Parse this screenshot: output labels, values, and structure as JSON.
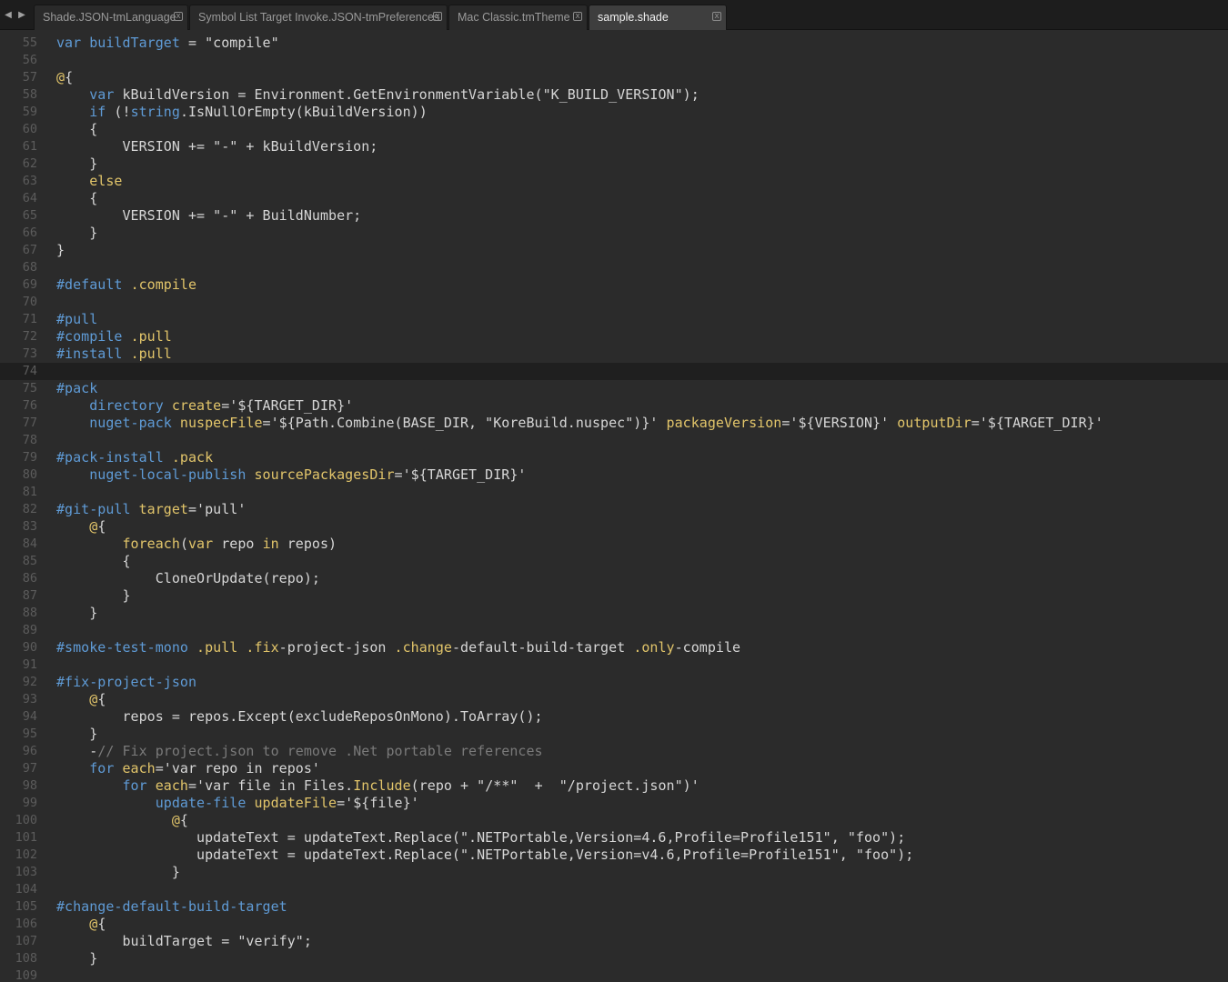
{
  "tabbar": {
    "back_arrow": "◀",
    "forward_arrow": "▶",
    "close_glyph": "x",
    "tabs": [
      {
        "label": "Shade.JSON-tmLanguage",
        "active": false
      },
      {
        "label": "Symbol List Target Invoke.JSON-tmPreferences",
        "active": false
      },
      {
        "label": "Mac Classic.tmTheme",
        "active": false
      },
      {
        "label": "sample.shade",
        "active": true
      }
    ]
  },
  "editor": {
    "current_line": 74,
    "colors": {
      "background": "#2b2b2b",
      "keyword_blue": "#5f9bd6",
      "keyword_gold": "#e2c56a",
      "comment": "#7a7a7a",
      "text": "#d6d6d6"
    },
    "lines": [
      {
        "n": "55",
        "segs": [
          [
            "k",
            "var"
          ],
          [
            "t",
            " "
          ],
          [
            "k",
            "buildTarget"
          ],
          [
            "t",
            " = \"compile\""
          ]
        ]
      },
      {
        "n": "56",
        "segs": []
      },
      {
        "n": "57",
        "segs": [
          [
            "y",
            "@"
          ],
          [
            "t",
            "{"
          ]
        ]
      },
      {
        "n": "58",
        "segs": [
          [
            "t",
            "    "
          ],
          [
            "k",
            "var"
          ],
          [
            "t",
            " kBuildVersion = Environment.GetEnvironmentVariable(\"K_BUILD_VERSION\");"
          ]
        ]
      },
      {
        "n": "59",
        "segs": [
          [
            "t",
            "    "
          ],
          [
            "k",
            "if"
          ],
          [
            "t",
            " (!"
          ],
          [
            "k",
            "string"
          ],
          [
            "t",
            ".IsNullOrEmpty(kBuildVersion))"
          ]
        ]
      },
      {
        "n": "60",
        "segs": [
          [
            "t",
            "    {"
          ]
        ]
      },
      {
        "n": "61",
        "segs": [
          [
            "t",
            "        VERSION += \"-\" + kBuildVersion;"
          ]
        ]
      },
      {
        "n": "62",
        "segs": [
          [
            "t",
            "    }"
          ]
        ]
      },
      {
        "n": "63",
        "segs": [
          [
            "t",
            "    "
          ],
          [
            "y",
            "else"
          ]
        ]
      },
      {
        "n": "64",
        "segs": [
          [
            "t",
            "    {"
          ]
        ]
      },
      {
        "n": "65",
        "segs": [
          [
            "t",
            "        VERSION += \"-\" + BuildNumber;"
          ]
        ]
      },
      {
        "n": "66",
        "segs": [
          [
            "t",
            "    }"
          ]
        ]
      },
      {
        "n": "67",
        "segs": [
          [
            "t",
            "}"
          ]
        ]
      },
      {
        "n": "68",
        "segs": []
      },
      {
        "n": "69",
        "segs": [
          [
            "k",
            "#default"
          ],
          [
            "t",
            " "
          ],
          [
            "y",
            ".compile"
          ]
        ]
      },
      {
        "n": "70",
        "segs": []
      },
      {
        "n": "71",
        "segs": [
          [
            "k",
            "#pull"
          ]
        ]
      },
      {
        "n": "72",
        "segs": [
          [
            "k",
            "#compile"
          ],
          [
            "t",
            " "
          ],
          [
            "y",
            ".pull"
          ]
        ]
      },
      {
        "n": "73",
        "segs": [
          [
            "k",
            "#install"
          ],
          [
            "t",
            " "
          ],
          [
            "y",
            ".pull"
          ]
        ]
      },
      {
        "n": "74",
        "segs": []
      },
      {
        "n": "75",
        "segs": [
          [
            "k",
            "#pack"
          ]
        ]
      },
      {
        "n": "76",
        "segs": [
          [
            "t",
            "    "
          ],
          [
            "k",
            "directory"
          ],
          [
            "t",
            " "
          ],
          [
            "y",
            "create"
          ],
          [
            "t",
            "='${TARGET_DIR}'"
          ]
        ]
      },
      {
        "n": "77",
        "segs": [
          [
            "t",
            "    "
          ],
          [
            "k",
            "nuget-pack"
          ],
          [
            "t",
            " "
          ],
          [
            "y",
            "nuspecFile"
          ],
          [
            "t",
            "='${Path.Combine(BASE_DIR, \"KoreBuild.nuspec\")}' "
          ],
          [
            "y",
            "packageVersion"
          ],
          [
            "t",
            "='${VERSION}' "
          ],
          [
            "y",
            "outputDir"
          ],
          [
            "t",
            "='${TARGET_DIR}'"
          ]
        ]
      },
      {
        "n": "78",
        "segs": []
      },
      {
        "n": "79",
        "segs": [
          [
            "k",
            "#pack-install"
          ],
          [
            "t",
            " "
          ],
          [
            "y",
            ".pack"
          ]
        ]
      },
      {
        "n": "80",
        "segs": [
          [
            "t",
            "    "
          ],
          [
            "k",
            "nuget-local-publish"
          ],
          [
            "t",
            " "
          ],
          [
            "y",
            "sourcePackagesDir"
          ],
          [
            "t",
            "='${TARGET_DIR}'"
          ]
        ]
      },
      {
        "n": "81",
        "segs": []
      },
      {
        "n": "82",
        "segs": [
          [
            "k",
            "#git-pull"
          ],
          [
            "t",
            " "
          ],
          [
            "y",
            "target"
          ],
          [
            "t",
            "='pull'"
          ]
        ]
      },
      {
        "n": "83",
        "segs": [
          [
            "t",
            "    "
          ],
          [
            "y",
            "@"
          ],
          [
            "t",
            "{"
          ]
        ]
      },
      {
        "n": "84",
        "segs": [
          [
            "t",
            "        "
          ],
          [
            "y",
            "foreach"
          ],
          [
            "t",
            "("
          ],
          [
            "y",
            "var"
          ],
          [
            "t",
            " repo "
          ],
          [
            "y",
            "in"
          ],
          [
            "t",
            " repos)"
          ]
        ]
      },
      {
        "n": "85",
        "segs": [
          [
            "t",
            "        {"
          ]
        ]
      },
      {
        "n": "86",
        "segs": [
          [
            "t",
            "            CloneOrUpdate(repo);"
          ]
        ]
      },
      {
        "n": "87",
        "segs": [
          [
            "t",
            "        }"
          ]
        ]
      },
      {
        "n": "88",
        "segs": [
          [
            "t",
            "    }"
          ]
        ]
      },
      {
        "n": "89",
        "segs": []
      },
      {
        "n": "90",
        "segs": [
          [
            "k",
            "#smoke-test-mono"
          ],
          [
            "t",
            " "
          ],
          [
            "y",
            ".pull"
          ],
          [
            "t",
            " "
          ],
          [
            "y",
            ".fix"
          ],
          [
            "t",
            "-project-json "
          ],
          [
            "y",
            ".change"
          ],
          [
            "t",
            "-default-build-target "
          ],
          [
            "y",
            ".only"
          ],
          [
            "t",
            "-compile"
          ]
        ]
      },
      {
        "n": "91",
        "segs": []
      },
      {
        "n": "92",
        "segs": [
          [
            "k",
            "#fix-project-json"
          ]
        ]
      },
      {
        "n": "93",
        "segs": [
          [
            "t",
            "    "
          ],
          [
            "y",
            "@"
          ],
          [
            "t",
            "{"
          ]
        ]
      },
      {
        "n": "94",
        "segs": [
          [
            "t",
            "        repos = repos.Except(excludeReposOnMono).ToArray();"
          ]
        ]
      },
      {
        "n": "95",
        "segs": [
          [
            "t",
            "    }"
          ]
        ]
      },
      {
        "n": "96",
        "segs": [
          [
            "t",
            "    -"
          ],
          [
            "c",
            "// Fix project.json to remove .Net portable references"
          ]
        ]
      },
      {
        "n": "97",
        "segs": [
          [
            "t",
            "    "
          ],
          [
            "k",
            "for"
          ],
          [
            "t",
            " "
          ],
          [
            "y",
            "each"
          ],
          [
            "t",
            "='var repo in repos'"
          ]
        ]
      },
      {
        "n": "98",
        "segs": [
          [
            "t",
            "        "
          ],
          [
            "k",
            "for"
          ],
          [
            "t",
            " "
          ],
          [
            "y",
            "each"
          ],
          [
            "t",
            "='var file in Files."
          ],
          [
            "y",
            "Include"
          ],
          [
            "t",
            "(repo + \"/**\"  +  \"/project.json\")'"
          ]
        ]
      },
      {
        "n": "99",
        "segs": [
          [
            "t",
            "            "
          ],
          [
            "k",
            "update-file"
          ],
          [
            "t",
            " "
          ],
          [
            "y",
            "updateFile"
          ],
          [
            "t",
            "='${file}'"
          ]
        ]
      },
      {
        "n": "100",
        "segs": [
          [
            "t",
            "              "
          ],
          [
            "y",
            "@"
          ],
          [
            "t",
            "{"
          ]
        ]
      },
      {
        "n": "101",
        "segs": [
          [
            "t",
            "                 updateText = updateText.Replace(\".NETPortable,Version=4.6,Profile=Profile151\", \"foo\");"
          ]
        ]
      },
      {
        "n": "102",
        "segs": [
          [
            "t",
            "                 updateText = updateText.Replace(\".NETPortable,Version=v4.6,Profile=Profile151\", \"foo\");"
          ]
        ]
      },
      {
        "n": "103",
        "segs": [
          [
            "t",
            "              }"
          ]
        ]
      },
      {
        "n": "104",
        "segs": []
      },
      {
        "n": "105",
        "segs": [
          [
            "k",
            "#change-default-build-target"
          ]
        ]
      },
      {
        "n": "106",
        "segs": [
          [
            "t",
            "    "
          ],
          [
            "y",
            "@"
          ],
          [
            "t",
            "{"
          ]
        ]
      },
      {
        "n": "107",
        "segs": [
          [
            "t",
            "        buildTarget = \"verify\";"
          ]
        ]
      },
      {
        "n": "108",
        "segs": [
          [
            "t",
            "    }"
          ]
        ]
      },
      {
        "n": "109",
        "segs": []
      }
    ]
  }
}
